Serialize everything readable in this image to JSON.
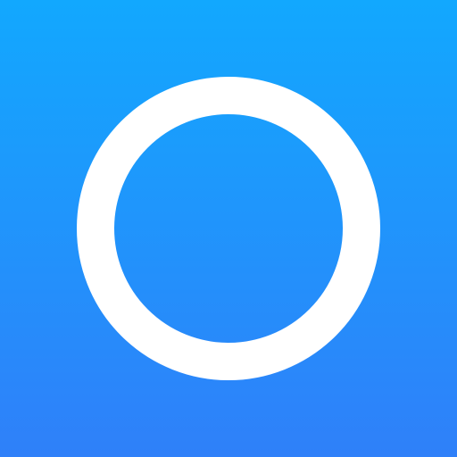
{
  "icon": {
    "name": "ring-icon",
    "background_top": "#12a8fe",
    "background_bottom": "#2f80f9",
    "ring_color": "#ffffff"
  }
}
